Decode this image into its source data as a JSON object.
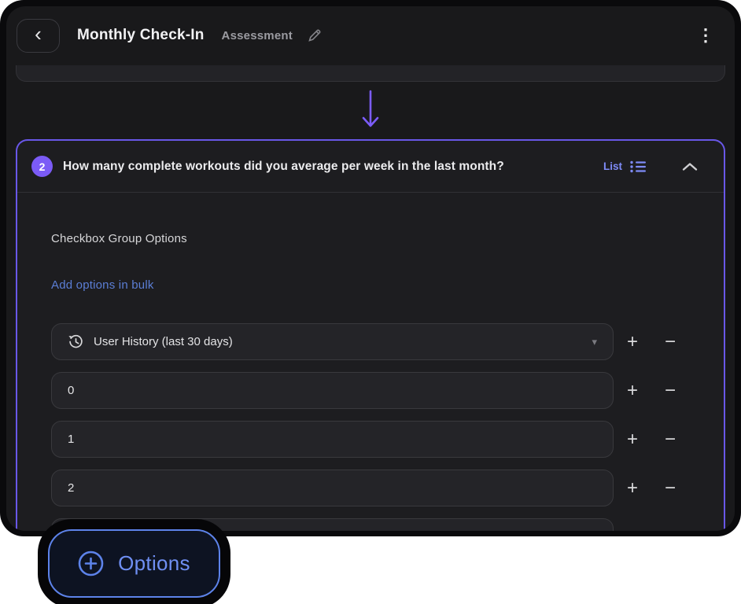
{
  "header": {
    "title": "Monthly Check-In",
    "subtitle": "Assessment"
  },
  "icons": {
    "back": "‹",
    "kebab": "⋮",
    "plus": "+",
    "minus": "−",
    "caret_down": "▾"
  },
  "question": {
    "number": "2",
    "text": "How many complete workouts did you average per week in the last month?",
    "type_label": "List",
    "section_title": "Checkbox Group Options",
    "bulk_add_label": "Add options in bulk",
    "options": [
      {
        "value": "User History (last 30 days)"
      },
      {
        "value": "0"
      },
      {
        "value": "1"
      },
      {
        "value": "2"
      }
    ]
  },
  "footer": {
    "options_button_label": "Options"
  },
  "colors": {
    "accent_purple": "#7b5bf6",
    "card_border_purple": "#6957e8",
    "list_label_purple": "#7e8bf7",
    "link_blue": "#5b7ed5",
    "button_blue": "#5d83ea",
    "surface": "#19191b",
    "card": "#1d1d20",
    "field": "#242428"
  }
}
